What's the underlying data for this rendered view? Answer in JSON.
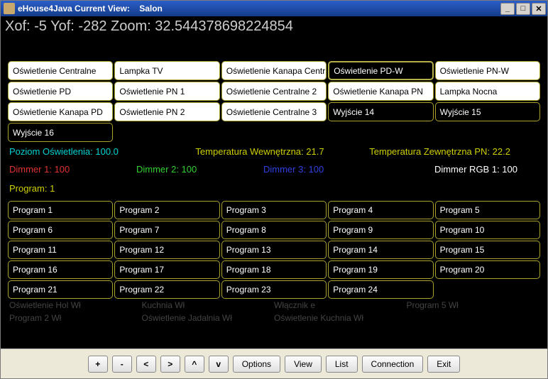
{
  "titlebar": {
    "app": "eHouse4Java Current View:",
    "room": "Salon"
  },
  "coords": "Xof: -5 Yof: -282 Zoom: 32.544378698224854",
  "outputs": [
    {
      "label": "Oświetlenie Centralne",
      "on": true
    },
    {
      "label": "Lampka TV",
      "on": true
    },
    {
      "label": "Oświetlenie Kanapa Centr",
      "on": true
    },
    {
      "label": "Oświetlenie PD-W",
      "on": false,
      "selected": true
    },
    {
      "label": "Oświetlenie PN-W",
      "on": true
    },
    {
      "label": "Oświetlenie PD",
      "on": true
    },
    {
      "label": "Oświetlenie PN 1",
      "on": true
    },
    {
      "label": "Oświetlenie Centralne 2",
      "on": true
    },
    {
      "label": "Oświetlenie Kanapa PN",
      "on": true
    },
    {
      "label": "Lampka Nocna",
      "on": true
    },
    {
      "label": "Oświetlenie Kanapa PD",
      "on": true
    },
    {
      "label": "Oświetlenie PN 2",
      "on": true
    },
    {
      "label": "Oświetlenie Centralne 3",
      "on": true
    },
    {
      "label": "Wyjście 14",
      "on": false
    },
    {
      "label": "Wyjście 15",
      "on": false
    },
    {
      "label": "Wyjście 16",
      "on": false
    }
  ],
  "status": {
    "light": "Poziom Oświetlenia: 100.0",
    "temp_in": "Temperatura Wewnętrzna: 21.7",
    "temp_out": "Temperatura Zewnętrzna PN: 22.2"
  },
  "dimmers": {
    "d1": "Dimmer 1: 100",
    "d2": "Dimmer 2: 100",
    "d3": "Dimmer 3: 100",
    "d4": "Dimmer RGB 1: 100"
  },
  "program_label": "Program: 1",
  "programs": [
    "Program 1",
    "Program 2",
    "Program 3",
    "Program 4",
    "Program 5",
    "Program 6",
    "Program 7",
    "Program 8",
    "Program 9",
    "Program 10",
    "Program 11",
    "Program 12",
    "Program 13",
    "Program 14",
    "Program 15",
    "Program 16",
    "Program 17",
    "Program 18",
    "Program 19",
    "Program 20",
    "Program 21",
    "Program 22",
    "Program 23",
    "Program 24"
  ],
  "ghost": {
    "g1a": "Oświetlenie Hol Wł",
    "g1b": "Program 2 Wł",
    "g2a": "Kuchnia Wł",
    "g2b": "Oświetlenie Jadalnia Wł",
    "g3a": "Włącznik e",
    "g3b": "Oświetlenie Kuchnia Wł",
    "g4": "Program 5 Wł"
  },
  "toolbar": {
    "plus": "+",
    "minus": "-",
    "left": "<",
    "right": ">",
    "up": "^",
    "down": "v",
    "options": "Options",
    "view": "View",
    "list": "List",
    "connection": "Connection",
    "exit": "Exit"
  }
}
